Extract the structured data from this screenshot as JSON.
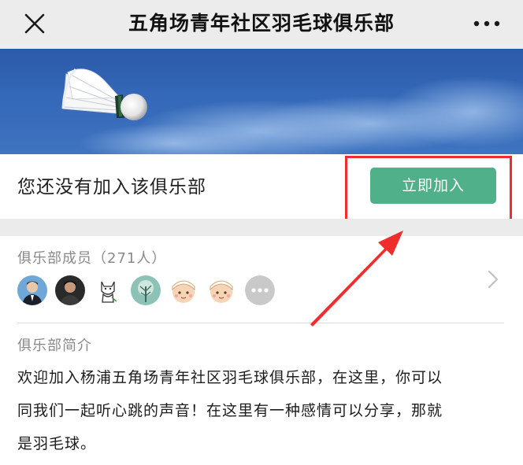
{
  "navbar": {
    "title": "五角场青年社区羽毛球俱乐部",
    "close_icon": "close-icon",
    "more_icon": "more-icon"
  },
  "banner": {
    "image": "shuttlecock-on-blue-sky"
  },
  "join": {
    "status_text": "您还没有加入该俱乐部",
    "button_label": "立即加入",
    "button_color": "#4fb08a",
    "annotation_color": "#f02d2d"
  },
  "members": {
    "title": "俱乐部成员（271人）",
    "avatars": [
      "avatar-man-suit",
      "avatar-man-dark",
      "avatar-cat-drawing",
      "avatar-tree-green",
      "avatar-cartoon-boy",
      "avatar-cartoon-boy",
      "avatar-more"
    ]
  },
  "intro": {
    "title": "俱乐部简介",
    "line1": "欢迎加入杨浦五角场青年社区羽毛球俱乐部，在这里，你可以",
    "line2": "同我们一起听心跳的声音！在这里有一种感情可以分享，那就",
    "line3": "是羽毛球。"
  }
}
